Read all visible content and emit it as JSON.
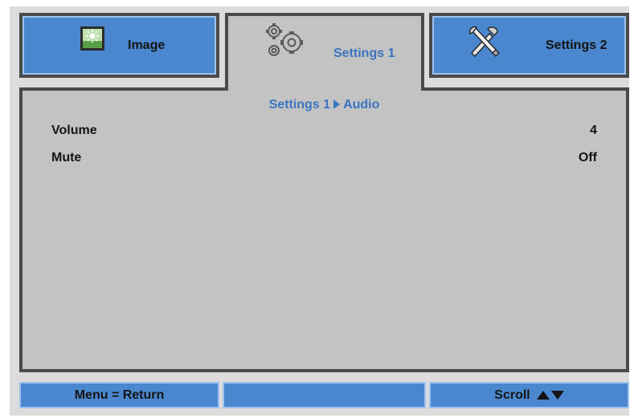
{
  "tabs": {
    "image": {
      "label": "Image",
      "icon": "image-icon"
    },
    "settings1": {
      "label": "Settings 1",
      "icon": "gears-icon",
      "selected": true
    },
    "settings2": {
      "label": "Settings 2",
      "icon": "tools-icon"
    }
  },
  "breadcrumb": {
    "parent": "Settings 1",
    "current": "Audio"
  },
  "settings": [
    {
      "name": "Volume",
      "value": "4"
    },
    {
      "name": "Mute",
      "value": "Off"
    }
  ],
  "footer": {
    "left": "Menu = Return",
    "middle": "",
    "right": "Scroll"
  },
  "colors": {
    "tab_blue": "#4a87cf",
    "panel_gray": "#c3c3c3",
    "accent_text": "#3b74c0",
    "border_dark": "#4a4a4a"
  }
}
